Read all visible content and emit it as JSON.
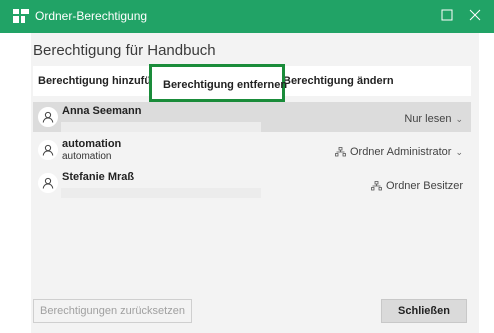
{
  "window": {
    "title": "Ordner-Berechtigung",
    "heading": "Berechtigung für Handbuch",
    "accent_color": "#21a366",
    "highlight_color": "#1a8c3a"
  },
  "toolbar": {
    "add_label": "Berechtigung hinzufügen",
    "remove_label": "Berechtigung entfernen",
    "change_label": "Berechtigung ändern"
  },
  "members": [
    {
      "name": "Anna Seemann",
      "subtitle": "",
      "permission": "Nur lesen",
      "has_dropdown": true,
      "icon": "person-icon",
      "perm_icon": "",
      "selected": true
    },
    {
      "name": "automation",
      "subtitle": "automation",
      "permission": "Ordner Administrator",
      "has_dropdown": true,
      "icon": "person-icon",
      "perm_icon": "org-icon",
      "selected": false
    },
    {
      "name": "Stefanie Mraß",
      "subtitle": "",
      "permission": "Ordner Besitzer",
      "has_dropdown": false,
      "icon": "person-icon",
      "perm_icon": "org-icon",
      "selected": false
    }
  ],
  "footer": {
    "reset_label": "Berechtigungen zurücksetzen",
    "close_label": "Schließen"
  }
}
